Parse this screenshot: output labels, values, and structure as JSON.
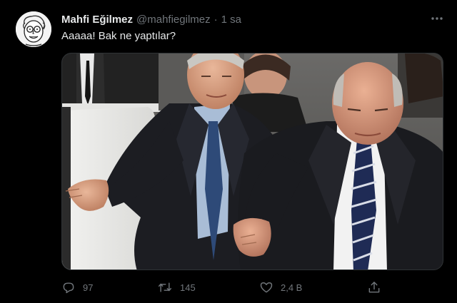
{
  "tweet": {
    "author_name": "Mahfi Eğilmez",
    "author_handle": "@mahfiegilmez",
    "separator": "·",
    "timestamp": "1 sa",
    "text": "Aaaaa! Bak ne yaptılar?"
  },
  "actions": {
    "reply_count": "97",
    "retweet_count": "145",
    "like_count": "2,4 B"
  },
  "icons": {
    "avatar": "caricature-avatar",
    "more": "more-icon",
    "reply": "reply-icon",
    "retweet": "retweet-icon",
    "like": "heart-icon",
    "share": "share-icon"
  },
  "colors": {
    "background": "#000000",
    "text": "#e7e9ea",
    "secondary": "#71767b"
  }
}
